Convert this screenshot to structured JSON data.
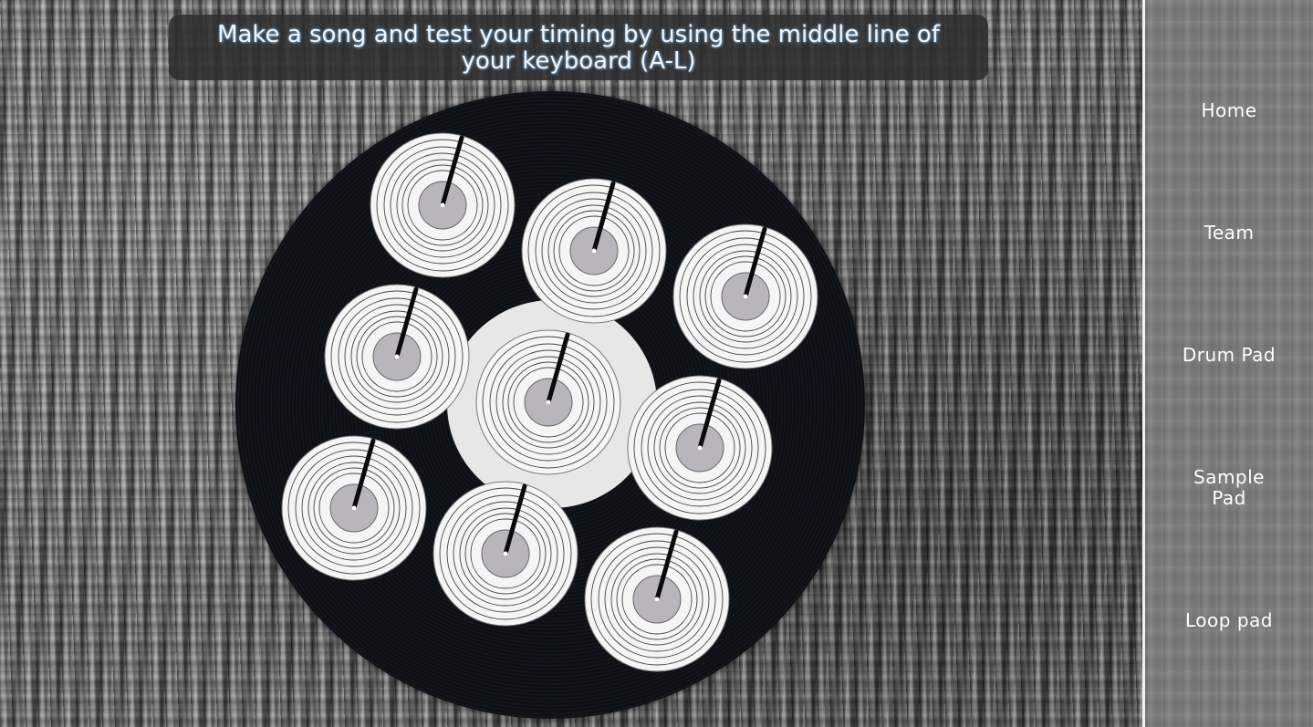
{
  "header": {
    "instruction": "Make a song and test your timing by using the middle line of your keyboard (A-L)"
  },
  "sidebar": {
    "items": [
      {
        "label": "Home"
      },
      {
        "label": "Team"
      },
      {
        "label": "Drum Pad"
      },
      {
        "label": "Sample Pad"
      },
      {
        "label": "Loop pad"
      }
    ]
  },
  "pads": {
    "count": 9,
    "icon": "turntable-record-icon"
  },
  "colors": {
    "banner_bg": "#2d2d2d",
    "text": "#ffffff",
    "record": "#0b0d11",
    "pad_face": "#f5f5f5",
    "pad_center": "#b9b6bb"
  }
}
